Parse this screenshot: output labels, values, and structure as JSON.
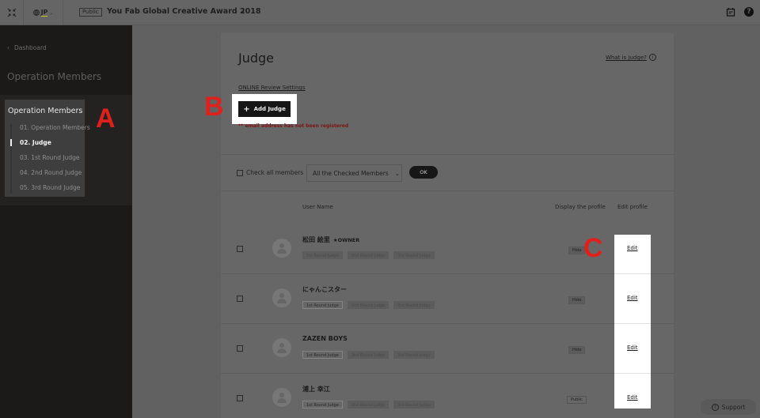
{
  "topbar": {
    "language": "JP",
    "visibility_badge": "Public",
    "project_title": "You Fab Global Creative Award 2018"
  },
  "sidebar": {
    "back_label": "Dashboard",
    "section_title": "Operation Members",
    "box_title": "Operation Members",
    "items": [
      {
        "label": "01. Operation Members",
        "active": false
      },
      {
        "label": "02. Judge",
        "active": true
      },
      {
        "label": "03. 1st Round Judge",
        "active": false
      },
      {
        "label": "04. 2nd Round Judge",
        "active": false
      },
      {
        "label": "05. 3rd Round Judge",
        "active": false
      }
    ]
  },
  "annotations": {
    "a": "A",
    "b": "B",
    "c": "C"
  },
  "main": {
    "title": "Judge",
    "help_link": "What is Judge?",
    "info_icon": "i",
    "online_review_link": "ONLINE Review Settings",
    "add_judge_label": "Add Judge",
    "add_icon": "+",
    "error_text": "** email address has not been registered",
    "bulk": {
      "check_all_label": "Check all members",
      "select_value": "All the Checked Members",
      "ok_label": "OK"
    },
    "columns": {
      "user_name": "User Name",
      "display_profile": "Display the profile",
      "edit_profile": "Edit profile"
    },
    "rows": [
      {
        "name": "松田 絵里",
        "owner_badge": "★OWNER",
        "tags": [
          {
            "label": "1st Round Judge",
            "active": false
          },
          {
            "label": "2nd Round Judge",
            "active": false
          },
          {
            "label": "3rd Round Judge",
            "active": false
          }
        ],
        "display": "Hide",
        "edit": "Edit"
      },
      {
        "name": "にゃんこスター",
        "owner_badge": "",
        "tags": [
          {
            "label": "1st Round Judge",
            "active": true
          },
          {
            "label": "2nd Round Judge",
            "active": false
          },
          {
            "label": "3rd Round Judge",
            "active": false
          }
        ],
        "display": "Hide",
        "edit": "Edit"
      },
      {
        "name": "ZAZEN BOYS",
        "owner_badge": "",
        "tags": [
          {
            "label": "1st Round Judge",
            "active": true
          },
          {
            "label": "2nd Round Judge",
            "active": false
          },
          {
            "label": "3rd Round Judge",
            "active": false
          }
        ],
        "display": "Hide",
        "edit": "Edit"
      },
      {
        "name": "浦上 幸江",
        "owner_badge": "",
        "tags": [
          {
            "label": "1st Round Judge",
            "active": true
          },
          {
            "label": "2nd Round Judge",
            "active": false
          },
          {
            "label": "3rd Round Judge",
            "active": false
          }
        ],
        "display": "Public",
        "edit": "Edit"
      }
    ]
  },
  "support": {
    "label": "Support",
    "icon": "?"
  }
}
